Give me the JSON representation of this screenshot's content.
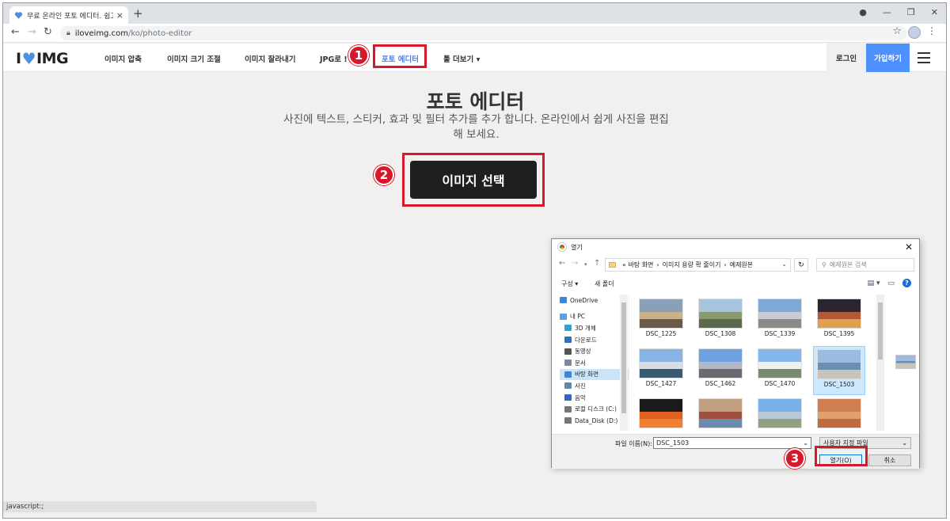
{
  "browser": {
    "tab_title": "무료 온라인 포토 에디터. 쉽고 !",
    "tab_close": "×",
    "new_tab": "+",
    "url_host": "iloveimg.com",
    "url_path": "/ko/photo-editor",
    "status": "javascript:;"
  },
  "site": {
    "logo_i": "I",
    "logo_img": "IMG",
    "menu": {
      "compress": "이미지 압축",
      "resize": "이미지 크기 조절",
      "crop": "이미지 잘라내기",
      "jpg": "JPG로 !",
      "editor": "포토 에디터",
      "more": "툴 더보기 ▾"
    },
    "login": "로그인",
    "signup": "가입하기",
    "accent": "#4d90fe"
  },
  "main": {
    "title": "포토 에디터",
    "subtitle": "사진에 텍스트, 스티커, 효과 및 필터 추가를 추가 합니다. 온라인에서 쉽게 사진을 편집해 보세요.",
    "select_button": "이미지 선택"
  },
  "badges": [
    "1",
    "2",
    "3"
  ],
  "annotation_color": "#d7182a",
  "dialog": {
    "title": "열기",
    "path": [
      "« 바탕 화면",
      "이미지 용량 확 줄이기",
      "예제원본"
    ],
    "search_placeholder": "예제원본 검색",
    "organize": "구성 ▾",
    "new_folder": "새 폴더",
    "tree": [
      {
        "label": "OneDrive",
        "icon": "cloud-icon",
        "color": "#3a86d8"
      },
      {
        "label": "내 PC",
        "icon": "pc-icon",
        "color": "#5aa0e0"
      },
      {
        "label": "3D 개체",
        "icon": "cube-icon",
        "color": "#2fa0d0"
      },
      {
        "label": "다운로드",
        "icon": "download-icon",
        "color": "#3070c0"
      },
      {
        "label": "동영상",
        "icon": "video-icon",
        "color": "#555555"
      },
      {
        "label": "문서",
        "icon": "document-icon",
        "color": "#7a8aa0"
      },
      {
        "label": "바탕 화면",
        "icon": "desktop-icon",
        "color": "#3a86d8"
      },
      {
        "label": "사진",
        "icon": "pictures-icon",
        "color": "#5a8ab0"
      },
      {
        "label": "음악",
        "icon": "music-icon",
        "color": "#2a6ac0"
      },
      {
        "label": "로컬 디스크 (C:)",
        "icon": "drive-icon",
        "color": "#777777"
      },
      {
        "label": "Data_Disk (D:)",
        "icon": "drive-icon",
        "color": "#777777"
      }
    ],
    "files": [
      {
        "name": "DSC_1225",
        "colors": [
          "#8aa0b8",
          "#c9b28a",
          "#6b5a4a"
        ]
      },
      {
        "name": "DSC_1308",
        "colors": [
          "#a9c4dd",
          "#8a9a70",
          "#5a6a4a"
        ]
      },
      {
        "name": "DSC_1339",
        "colors": [
          "#7fa8d6",
          "#c8ccd2",
          "#8a8a8a"
        ]
      },
      {
        "name": "DSC_1395",
        "colors": [
          "#2a2530",
          "#b05a3a",
          "#e0a050"
        ]
      },
      {
        "name": "DSC_1427",
        "colors": [
          "#88b4e4",
          "#d8dde4",
          "#3a5a70"
        ]
      },
      {
        "name": "DSC_1462",
        "colors": [
          "#6fa0e0",
          "#b0b8c8",
          "#6a6a70"
        ]
      },
      {
        "name": "DSC_1470",
        "colors": [
          "#86b6ea",
          "#eef0f2",
          "#7a8a70"
        ]
      },
      {
        "name": "DSC_1503",
        "colors": [
          "#9dbbe0",
          "#6c8fb0",
          "#c7c4be"
        ]
      },
      {
        "name": "",
        "colors": [
          "#1a1a1a",
          "#e06020",
          "#f08030"
        ]
      },
      {
        "name": "",
        "colors": [
          "#c0a080",
          "#a05040",
          "#6a8ab0"
        ]
      },
      {
        "name": "",
        "colors": [
          "#7ab0e8",
          "#b8c8d8",
          "#90a080"
        ]
      },
      {
        "name": "",
        "colors": [
          "#d08050",
          "#e0a070",
          "#c06a40"
        ]
      }
    ],
    "selected_file": "DSC_1503",
    "filename_label": "파일 이름(N):",
    "filename_value": "DSC_1503",
    "filetype": "사용자 지정 파일",
    "open_button": "열기(O)",
    "cancel_button": "취소"
  }
}
